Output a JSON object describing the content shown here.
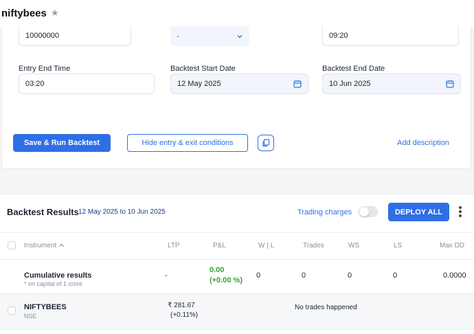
{
  "header": {
    "title": "niftybees",
    "star_icon": "star-icon"
  },
  "form": {
    "capital_value": "10000000",
    "dropdown_value": "-",
    "entry_start_time": "09:20",
    "entry_end_time_label": "Entry End Time",
    "entry_end_time_value": "03:20",
    "backtest_start_label": "Backtest Start Date",
    "backtest_start_value": "12 May 2025",
    "backtest_end_label": "Backtest End Date",
    "backtest_end_value": "10 Jun 2025"
  },
  "actions": {
    "save_run": "Save & Run Backtest",
    "hide_conditions": "Hide entry & exit conditions",
    "add_description": "Add description"
  },
  "results": {
    "title": "Backtest Results",
    "range": "12 May 2025 to 10 Jun 2025",
    "trading_charges": "Trading charges",
    "trading_charges_on": false,
    "deploy_all": "DEPLOY ALL",
    "columns": [
      "Instrument",
      "LTP",
      "P&L",
      "W | L",
      "Trades",
      "WS",
      "LS",
      "Max DD"
    ],
    "cumulative": {
      "name": "Cumulative results",
      "note": "* on capital of 1 crore",
      "ltp": "-",
      "pnl": "0.00",
      "pnl_pct": "(+0.00 %)",
      "wl": "0",
      "trades": "0",
      "ws": "0",
      "ls": "0",
      "max_dd": "0.0000"
    },
    "instrument_row": {
      "name": "NIFTYBEES",
      "exchange": "NSE",
      "ltp": "₹ 281.67",
      "ltp_change": "(+0.11%)",
      "message": "No trades happened"
    }
  },
  "colors": {
    "accent": "#2f6fe6",
    "profit": "#33a52b"
  }
}
